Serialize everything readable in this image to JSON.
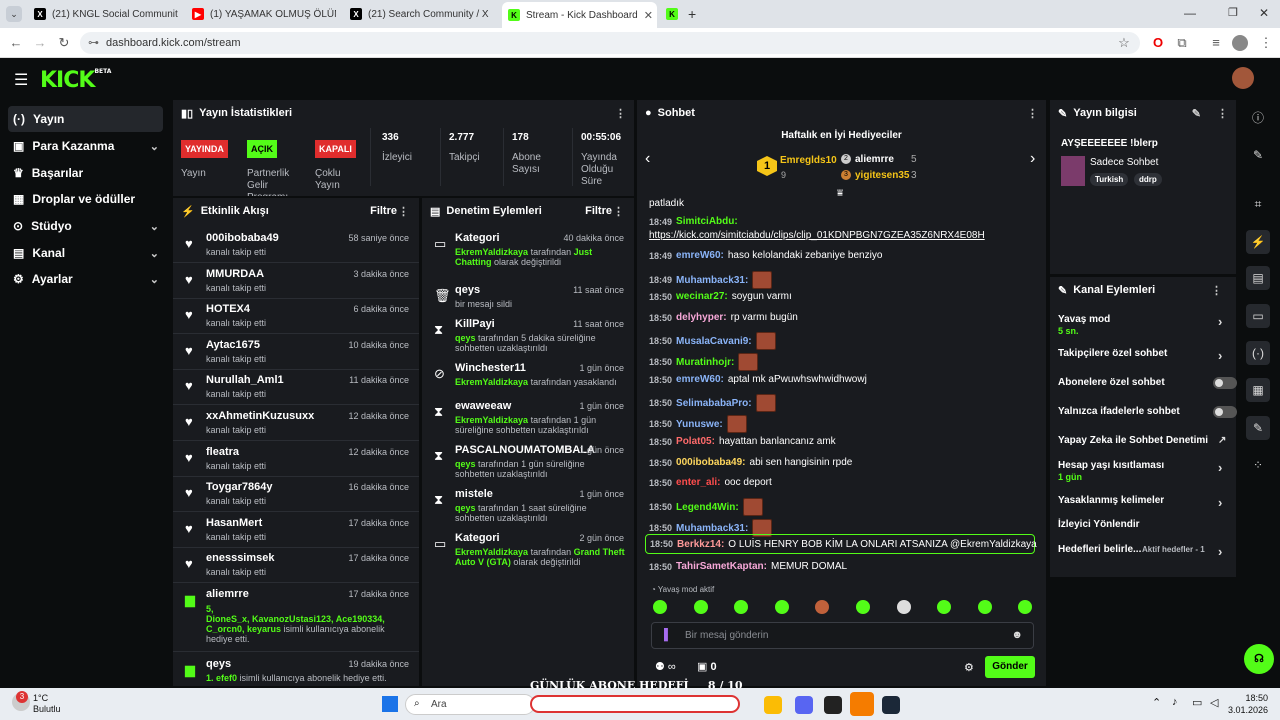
{
  "browser": {
    "tabs": [
      {
        "title": "(21) KNGL Social Community /",
        "icon": "x-logo-icon"
      },
      {
        "title": "(1) YAŞAMAK OLMUŞ ÖLÜMDE",
        "icon": "youtube-icon"
      },
      {
        "title": "(21) Search Community / X",
        "icon": "x-logo-icon"
      },
      {
        "title": "Stream - Kick Dashboard",
        "icon": "kick-icon"
      }
    ],
    "url": "dashboard.kick.com/stream"
  },
  "brand": {
    "logo": "KICK",
    "beta": "BETA",
    "accent": "#53fc18"
  },
  "sidebar": {
    "items": [
      {
        "label": "Yayın",
        "icon": "broadcast-icon"
      },
      {
        "label": "Para Kazanma",
        "icon": "money-icon"
      },
      {
        "label": "Başarılar",
        "icon": "trophy-icon"
      },
      {
        "label": "Droplar ve ödüller",
        "icon": "drops-icon"
      },
      {
        "label": "Stüdyo",
        "icon": "studio-icon"
      },
      {
        "label": "Kanal",
        "icon": "channel-icon"
      },
      {
        "label": "Ayarlar",
        "icon": "settings-icon"
      }
    ]
  },
  "stats": {
    "title": "Yayın İstatistikleri",
    "stream_badge": "YAYINDA",
    "stream_label": "Yayın",
    "partner_badge": "AÇIK",
    "partner_label": "Partnerlik Gelir Programı",
    "multi_badge": "KAPALI",
    "multi_label": "Çoklu Yayın",
    "viewers": "336",
    "viewers_label": "İzleyici",
    "followers": "2.777",
    "followers_label": "Takipçi",
    "subs": "178",
    "subs_label": "Abone Sayısı",
    "uptime": "00:55:06",
    "uptime_label": "Yayında Olduğu Süre"
  },
  "activity": {
    "title": "Etkinlik Akışı",
    "filter": "Filtre",
    "items": [
      {
        "name": "000ibobaba49",
        "sub": "kanalı takip etti",
        "time": "58 saniye önce"
      },
      {
        "name": "MMURDAA",
        "sub": "kanalı takip etti",
        "time": "3 dakika önce"
      },
      {
        "name": "HOTEX4",
        "sub": "kanalı takip etti",
        "time": "6 dakika önce"
      },
      {
        "name": "Aytac1675",
        "sub": "kanalı takip etti",
        "time": "10 dakika önce"
      },
      {
        "name": "Nurullah_Aml1",
        "sub": "kanalı takip etti",
        "time": "11 dakika önce"
      },
      {
        "name": "xxAhmetinKuzusuxx",
        "sub": "kanalı takip etti",
        "time": "12 dakika önce"
      },
      {
        "name": "fleatra",
        "sub": "kanalı takip etti",
        "time": "12 dakika önce"
      },
      {
        "name": "Toygar7864y",
        "sub": "kanalı takip etti",
        "time": "16 dakika önce"
      },
      {
        "name": "HasanMert",
        "sub": "kanalı takip etti",
        "time": "17 dakika önce"
      },
      {
        "name": "enesssimsek",
        "sub": "kanalı takip etti",
        "time": "17 dakika önce"
      }
    ],
    "gift1": {
      "name": "aliemrre",
      "time": "17 dakika önce",
      "count": "5,",
      "recipients": "DioneS_x, KavanozUstasi123, Ace190334, C_orcn0, keyarus",
      "note": "isimli kullanıcıya abonelik hediye etti."
    },
    "gift2": {
      "name": "qeys",
      "time": "19 dakika önce",
      "recipients": "1. efef0",
      "note": "isimli kullanıcıya abonelik hediye etti."
    }
  },
  "moderation": {
    "title": "Denetim Eylemleri",
    "filter": "Filtre",
    "items": [
      {
        "name": "Kategori",
        "time": "40 dakika önce",
        "actor": "EkremYaldizkaya",
        "text": "tarafından",
        "extra": "Just Chatting",
        "tail": "olarak değiştirildi",
        "icon": "category-icon"
      },
      {
        "name": "qeys",
        "time": "11 saat önce",
        "actor": "",
        "text": "bir mesajı sildi",
        "extra": "",
        "tail": "",
        "icon": "trash-icon"
      },
      {
        "name": "KillPayi",
        "time": "11 saat önce",
        "actor": "qeys",
        "text": "tarafından 5 dakika süreliğine sohbetten uzaklaştırıldı",
        "extra": "",
        "tail": "",
        "icon": "hourglass-icon"
      },
      {
        "name": "Winchester11",
        "time": "1 gün önce",
        "actor": "EkremYaldizkaya",
        "text": "tarafından yasaklandı",
        "extra": "",
        "tail": "",
        "icon": "ban-icon"
      },
      {
        "name": "ewaweeaw",
        "time": "1 gün önce",
        "actor": "EkremYaldizkaya",
        "text": "tarafından 1 gün süreliğine sohbetten uzaklaştırıldı",
        "extra": "",
        "tail": "",
        "icon": "hourglass-icon"
      },
      {
        "name": "PASCALNOUMATOMBALA",
        "time": "1 gün önce",
        "actor": "qeys",
        "text": "tarafından 1 gün süreliğine sohbetten uzaklaştırıldı",
        "extra": "",
        "tail": "",
        "icon": "hourglass-icon"
      },
      {
        "name": "mistele",
        "time": "1 gün önce",
        "actor": "qeys",
        "text": "tarafından 1 saat süreliğine sohbetten uzaklaştırıldı",
        "extra": "",
        "tail": "",
        "icon": "hourglass-icon"
      },
      {
        "name": "Kategori",
        "time": "2 gün önce",
        "actor": "EkremYaldizkaya",
        "text": "tarafından",
        "extra": "Grand Theft Auto V (GTA)",
        "tail": "olarak değiştirildi",
        "icon": "category-icon"
      }
    ]
  },
  "chat": {
    "title": "Sohbet",
    "gifters_title": "Haftalık en İyi Hediyeciler",
    "gifters": [
      {
        "rank": "1",
        "name": "Emreglds10",
        "count": "9"
      },
      {
        "rank": "2",
        "name": "aliemrre",
        "count": "5"
      },
      {
        "rank": "3",
        "name": "yigitesen35",
        "count": "3"
      }
    ],
    "messages": [
      {
        "time": "",
        "user": "",
        "color": "#fff",
        "text": "patladık"
      },
      {
        "time": "18:49",
        "user": "SimitciAbdu:",
        "color": "#53fc18",
        "text": ""
      },
      {
        "time": "",
        "user": "",
        "color": "#fff",
        "text": "https://kick.com/simitciabdu/clips/clip_01KDNPBGN7GZEA35Z6NRX4E08H"
      },
      {
        "time": "18:49",
        "user": "emreW60:",
        "color": "#8ab4f8",
        "text": "haso kelolandaki zebaniye benziyo"
      },
      {
        "time": "18:49",
        "user": "Muhamback31:",
        "color": "#8ab4f8",
        "text": ""
      },
      {
        "time": "18:50",
        "user": "wecinar27:",
        "color": "#53fc18",
        "text": "soygun varmı"
      },
      {
        "time": "18:50",
        "user": "delyhyper:",
        "color": "#f7a8d8",
        "text": "rp varmı bugün"
      },
      {
        "time": "18:50",
        "user": "MusalaCavani9:",
        "color": "#8ab4f8",
        "text": ""
      },
      {
        "time": "18:50",
        "user": "Muratinhojr:",
        "color": "#53fc18",
        "text": ""
      },
      {
        "time": "18:50",
        "user": "emreW60:",
        "color": "#8ab4f8",
        "text": "aptal mk aPwuwhswhwidhwowj"
      },
      {
        "time": "18:50",
        "user": "SelimababaPro:",
        "color": "#8ab4f8",
        "text": ""
      },
      {
        "time": "18:50",
        "user": "Yunuswe:",
        "color": "#8ab4f8",
        "text": ""
      },
      {
        "time": "18:50",
        "user": "Polat05:",
        "color": "#ff6b6b",
        "text": "hayattan banlancanız amk"
      },
      {
        "time": "18:50",
        "user": "000ibobaba49:",
        "color": "#ffd75e",
        "text": "abi sen hangisinin rpde"
      },
      {
        "time": "18:50",
        "user": "enter_ali:",
        "color": "#ff4d4d",
        "text": "ooc deport"
      },
      {
        "time": "18:50",
        "user": "Legend4Win:",
        "color": "#53fc18",
        "text": ""
      },
      {
        "time": "18:50",
        "user": "Muhamback31:",
        "color": "#8ab4f8",
        "text": ""
      },
      {
        "time": "18:50",
        "user": "Berkkz14:",
        "color": "#ff9a9a",
        "text": "O LUİS HENRY BOB KİM LA ONLARI ATSANIZA @EkremYaldizkaya"
      },
      {
        "time": "18:50",
        "user": "TahirSametKaptan:",
        "color": "#f7a8d8",
        "text": "MEMUR DOMAL"
      }
    ],
    "slow_mode": "Yavaş mod aktif",
    "input_placeholder": "Bir mesaj gönderin",
    "count": "0",
    "send": "Gönder",
    "overlay_text": "GÜNLÜK ABONE HEDEFİ",
    "overlay_count": "8 / 10"
  },
  "info": {
    "title": "Yayın bilgisi",
    "stream_title": "AYŞEEEEEEE !blerp",
    "category": "Sadece Sohbet",
    "tags": [
      "Turkish",
      "ddrp"
    ]
  },
  "actions": {
    "title": "Kanal Eylemleri",
    "items": [
      {
        "label": "Yavaş mod",
        "sub": "5 sn.",
        "kind": "arrow"
      },
      {
        "label": "Takipçilere özel sohbet",
        "sub": "",
        "kind": "arrow"
      },
      {
        "label": "Abonelere özel sohbet",
        "sub": "",
        "kind": "toggle"
      },
      {
        "label": "Yalnızca ifadelerle sohbet",
        "sub": "",
        "kind": "toggle"
      },
      {
        "label": "Yapay Zeka ile Sohbet Denetimi",
        "sub": "",
        "kind": "external"
      },
      {
        "label": "Hesap yaşı kısıtlaması",
        "sub": "1 gün",
        "kind": "arrow"
      },
      {
        "label": "Yasaklanmış kelimeler",
        "sub": "",
        "kind": "arrow"
      },
      {
        "label": "İzleyici Yönlendir",
        "sub": "",
        "kind": "none"
      },
      {
        "label": "Hedefleri belirle...",
        "sub": "",
        "kind": "arrow",
        "extra": "Aktif hedefler - 1"
      }
    ]
  },
  "taskbar": {
    "temp": "1°C",
    "weather": "Bulutlu",
    "search": "Ara",
    "time": "18:50",
    "date": "3.01.2026",
    "notif": "3"
  }
}
